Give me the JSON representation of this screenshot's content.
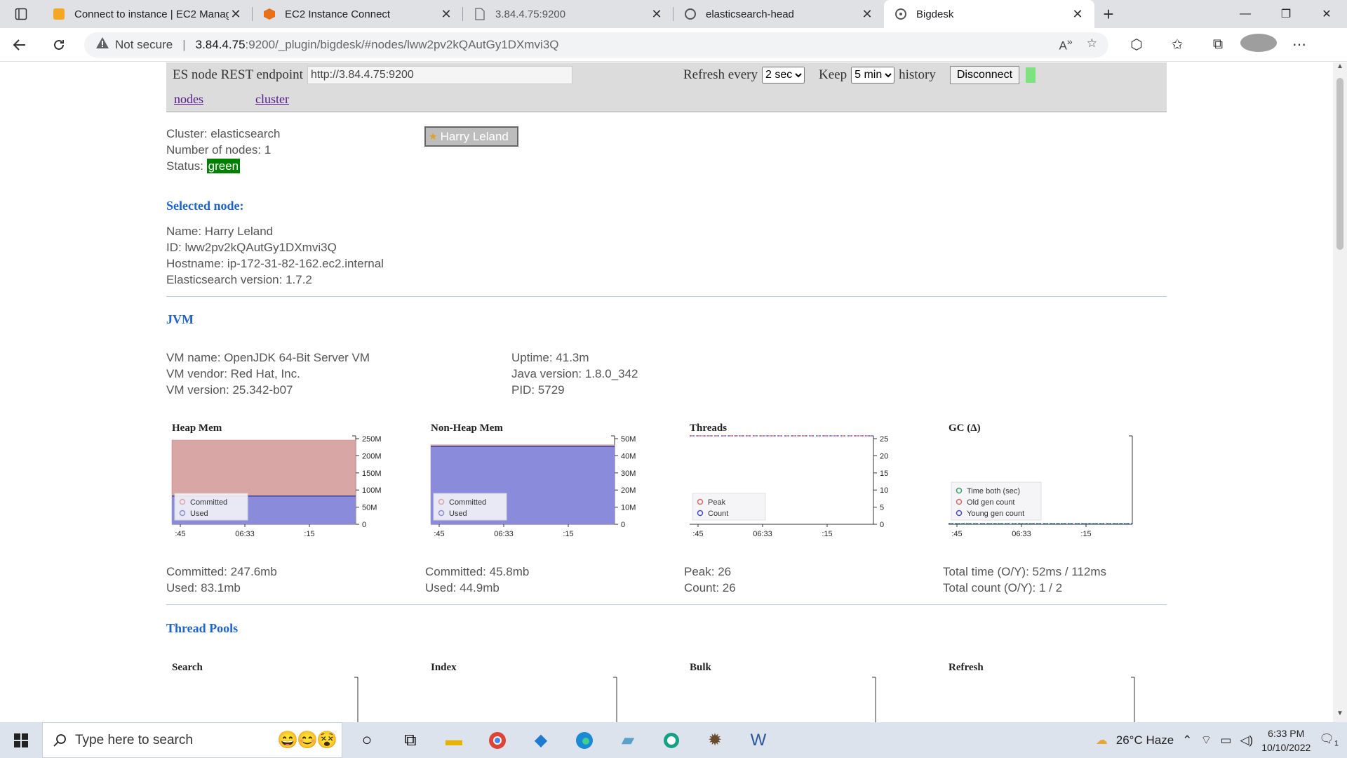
{
  "browser": {
    "tabs": [
      {
        "label": "Connect to instance | EC2 Manag",
        "icon": "aws-icon",
        "active": false
      },
      {
        "label": "EC2 Instance Connect",
        "icon": "ec2-icon",
        "active": false
      },
      {
        "label": "3.84.4.75:9200",
        "icon": "page-icon",
        "active": false
      },
      {
        "label": "elasticsearch-head",
        "icon": "head-icon",
        "active": false
      },
      {
        "label": "Bigdesk",
        "icon": "bigdesk-icon",
        "active": true
      }
    ],
    "security": "Not secure",
    "url_host": "3.84.4.75",
    "url_rest": ":9200/_plugin/bigdesk/#nodes/lww2pv2kQAutGy1DXmvi3Q"
  },
  "topbar": {
    "endpoint_label": "ES node REST endpoint",
    "endpoint_value": "http://3.84.4.75:9200",
    "refresh_label": "Refresh every",
    "refresh_value": "2 sec",
    "keep_label": "Keep",
    "keep_value": "5 min",
    "history_label": "history",
    "disconnect_label": "Disconnect"
  },
  "nav": {
    "nodes": "nodes",
    "cluster": "cluster"
  },
  "cluster": {
    "name_line": "Cluster: elasticsearch",
    "nodes_line": "Number of nodes: 1",
    "status_label": "Status:",
    "status_value": "green",
    "node_button": "Harry Leland"
  },
  "selected_node": {
    "heading": "Selected node:",
    "name": "Name: Harry Leland",
    "id": "ID: lww2pv2kQAutGy1DXmvi3Q",
    "hostname": "Hostname: ip-172-31-82-162.ec2.internal",
    "version": "Elasticsearch version: 1.7.2"
  },
  "jvm": {
    "heading": "JVM",
    "vm_name": "VM name: OpenJDK 64-Bit Server VM",
    "vm_vendor": "VM vendor: Red Hat, Inc.",
    "vm_version": "VM version: 25.342-b07",
    "uptime": "Uptime: 41.3m",
    "java_version": "Java version: 1.8.0_342",
    "pid": "PID: 5729"
  },
  "chart_data": [
    {
      "type": "area",
      "title": "Heap Mem",
      "x_ticks": [
        ":45",
        "06:33",
        ":15"
      ],
      "y_ticks": [
        "250M",
        "200M",
        "150M",
        "100M",
        "50M",
        "0"
      ],
      "ylim": [
        0,
        260
      ],
      "series": [
        {
          "name": "Committed",
          "color": "#d9a6a6",
          "values": [
            247.6,
            247.6
          ]
        },
        {
          "name": "Used",
          "color": "#8b8bdc",
          "values": [
            83.1,
            83.1
          ]
        }
      ],
      "legend_position": "bottom-left",
      "summary": [
        "Committed: 247.6mb",
        "Used: 83.1mb"
      ]
    },
    {
      "type": "area",
      "title": "Non-Heap Mem",
      "x_ticks": [
        ":45",
        "06:33",
        ":15"
      ],
      "y_ticks": [
        "50M",
        "40M",
        "30M",
        "20M",
        "10M",
        "0"
      ],
      "ylim": [
        0,
        51
      ],
      "series": [
        {
          "name": "Committed",
          "color": "#d9a6a6",
          "values": [
            45.8,
            45.8
          ]
        },
        {
          "name": "Used",
          "color": "#8b8bdc",
          "values": [
            44.9,
            44.9
          ]
        }
      ],
      "legend_position": "bottom-left",
      "summary": [
        "Committed: 45.8mb",
        "Used: 44.9mb"
      ]
    },
    {
      "type": "line",
      "title": "Threads",
      "x_ticks": [
        ":45",
        "06:33",
        ":15"
      ],
      "y_ticks": [
        "25",
        "20",
        "15",
        "10",
        "5",
        "0"
      ],
      "ylim": [
        0,
        26
      ],
      "series": [
        {
          "name": "Peak",
          "color": "#d96a6a",
          "values": [
            26,
            26
          ]
        },
        {
          "name": "Count",
          "color": "#4a4ad0",
          "values": [
            26,
            26
          ]
        }
      ],
      "legend_position": "bottom-left",
      "summary": [
        "Peak: 26",
        "Count: 26"
      ]
    },
    {
      "type": "line",
      "title": "GC (Δ)",
      "x_ticks": [
        ":45",
        "06:33",
        ":15"
      ],
      "y_ticks": [],
      "series": [
        {
          "name": "Time both (sec)",
          "color": "#3aa06a",
          "values": [
            0,
            0
          ]
        },
        {
          "name": "Old gen count",
          "color": "#d96a6a",
          "values": [
            0,
            0
          ]
        },
        {
          "name": "Young gen count",
          "color": "#4a4ad0",
          "values": [
            0,
            0
          ]
        }
      ],
      "legend_position": "bottom-left",
      "summary": [
        "Total time (O/Y): 52ms / 112ms",
        "Total count (O/Y): 1 / 2"
      ]
    }
  ],
  "thread_pools": {
    "heading": "Thread Pools",
    "pools": [
      "Search",
      "Index",
      "Bulk",
      "Refresh"
    ]
  },
  "taskbar": {
    "search_placeholder": "Type here to search",
    "weather": "26°C  Haze",
    "time": "6:33 PM",
    "date": "10/10/2022",
    "notifications": "1"
  }
}
